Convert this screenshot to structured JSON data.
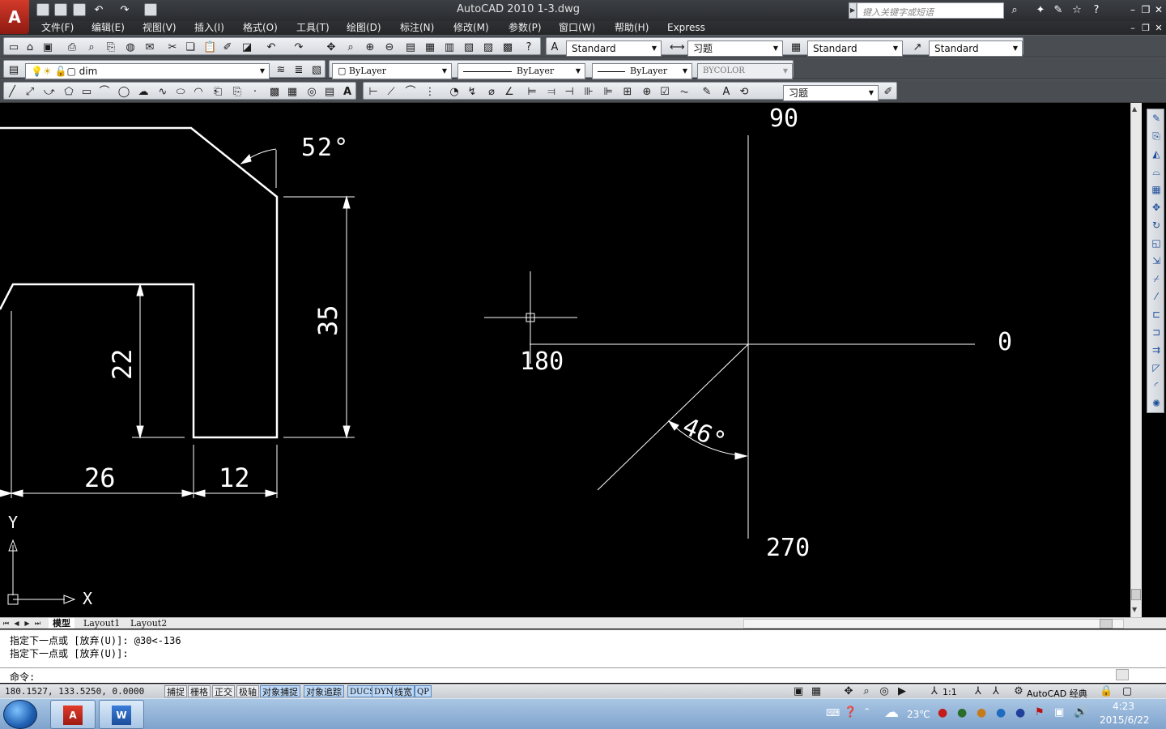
{
  "title": "AutoCAD 2010    1-3.dwg",
  "search_placeholder": "键入关键字或短语",
  "menu": [
    "文件(F)",
    "编辑(E)",
    "视图(V)",
    "插入(I)",
    "格式(O)",
    "工具(T)",
    "绘图(D)",
    "标注(N)",
    "修改(M)",
    "参数(P)",
    "窗口(W)",
    "帮助(H)",
    "Express"
  ],
  "styles": {
    "text_style": "Standard",
    "dim_style": "习题",
    "table_style": "Standard",
    "multileader_style": "Standard"
  },
  "layers": {
    "current_layer": "dim",
    "color": "ByLayer",
    "linetype": "ByLayer",
    "lineweight": "ByLayer",
    "plot_style": "BYCOLOR"
  },
  "draw_toolbar": {
    "dim_style_combo": "习题"
  },
  "drawing": {
    "dim_52": "52°",
    "dim_35": "35",
    "dim_22": "22",
    "dim_26": "26",
    "dim_12": "12",
    "angle_90": "90",
    "angle_0": "0",
    "angle_180": "180",
    "angle_270": "270",
    "dim_46": "46°",
    "ucs_x": "X",
    "ucs_y": "Y"
  },
  "layout_tabs": [
    "模型",
    "Layout1",
    "Layout2"
  ],
  "command": {
    "history_1": "指定下一点或 [放弃(U)]: @30<-136",
    "history_2": "指定下一点或 [放弃(U)]:",
    "prompt": "命令:"
  },
  "status": {
    "coords": "180.1527, 133.5250, 0.0000",
    "toggles": [
      "捕捉",
      "栅格",
      "正交",
      "极轴",
      "对象捕捉",
      "对象追踪",
      "DUCS",
      "DYN",
      "线宽",
      "QP"
    ],
    "active_toggles": [
      "对象捕捉",
      "对象追踪",
      "DUCS",
      "DYN",
      "线宽",
      "QP"
    ],
    "annotation_scale": "1:1",
    "workspace": "AutoCAD 经典"
  },
  "taskbar": {
    "temperature": "23℃",
    "time": "4:23",
    "date": "2015/6/22"
  }
}
